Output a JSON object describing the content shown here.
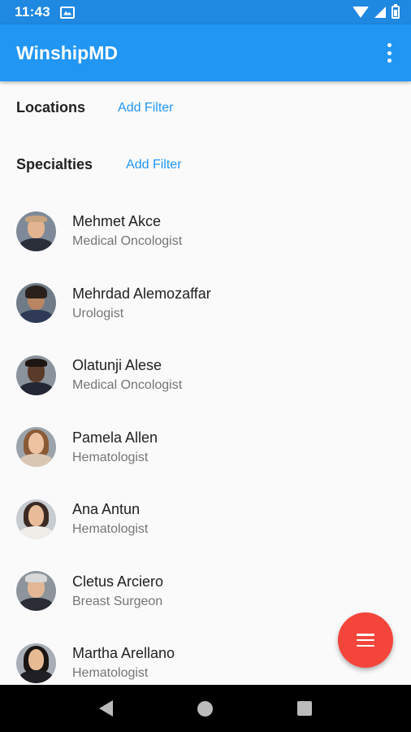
{
  "status_bar": {
    "time": "11:43"
  },
  "app_bar": {
    "title": "WinshipMD"
  },
  "filters": {
    "locations": {
      "label": "Locations",
      "action": "Add Filter"
    },
    "specialties": {
      "label": "Specialties",
      "action": "Add Filter"
    }
  },
  "doctors": [
    {
      "name": "Mehmet Akce",
      "specialty": "Medical Oncologist"
    },
    {
      "name": "Mehrdad Alemozaffar",
      "specialty": "Urologist"
    },
    {
      "name": "Olatunji Alese",
      "specialty": "Medical Oncologist"
    },
    {
      "name": "Pamela Allen",
      "specialty": "Hematologist"
    },
    {
      "name": "Ana Antun",
      "specialty": "Hematologist"
    },
    {
      "name": "Cletus Arciero",
      "specialty": "Breast Surgeon"
    },
    {
      "name": "Martha Arellano",
      "specialty": "Hematologist"
    }
  ],
  "colors": {
    "status_bar": "#1f88e1",
    "app_bar": "#2196f3",
    "link": "#2196f3",
    "fab": "#f4453b"
  },
  "icons": {
    "overflow": "more-vert-icon",
    "fab": "menu-icon",
    "nav": [
      "back-icon",
      "home-icon",
      "recents-icon"
    ]
  }
}
